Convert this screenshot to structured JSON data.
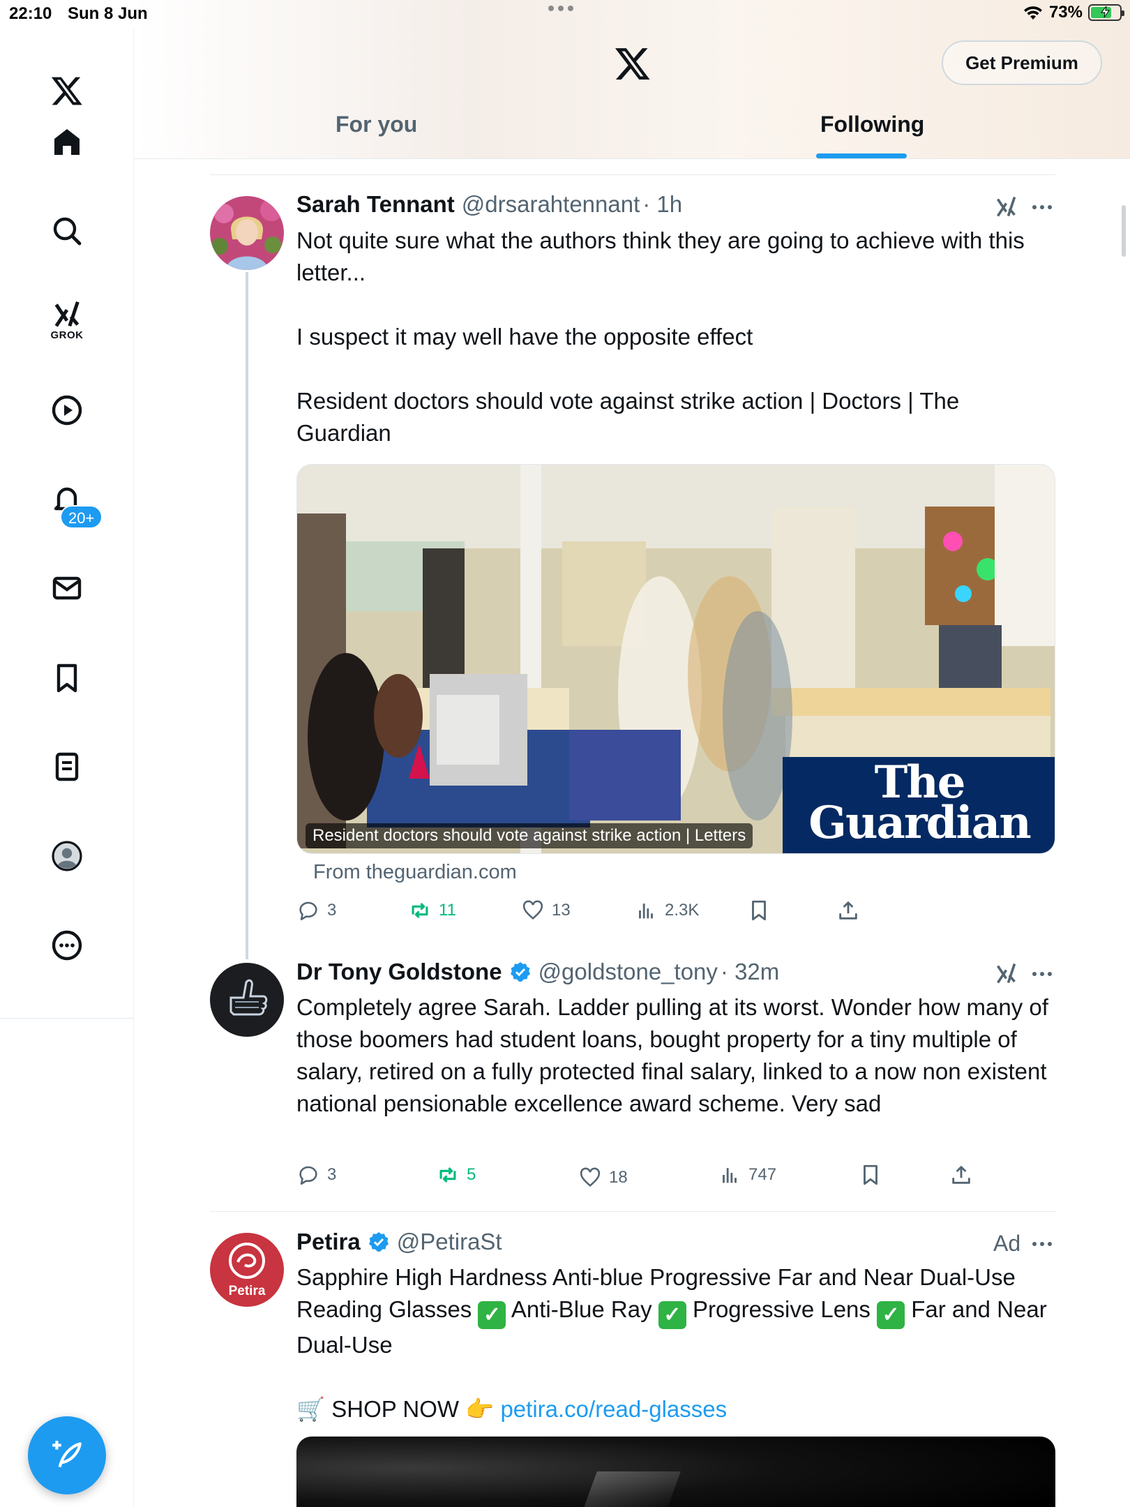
{
  "status_bar": {
    "time": "22:10",
    "date": "Sun 8 Jun",
    "battery": "73%",
    "battery_level": 0.73
  },
  "header": {
    "premium_label": "Get Premium",
    "tabs": [
      {
        "label": "For you",
        "active": false
      },
      {
        "label": "Following",
        "active": true
      }
    ]
  },
  "sidebar": {
    "grok_label": "GROK",
    "notifications_badge": "20+",
    "items": [
      "x-logo-icon",
      "home-icon",
      "search-icon",
      "grok-icon",
      "video-icon",
      "bell-icon",
      "mail-icon",
      "bookmark-icon",
      "list-icon",
      "profile-icon",
      "more-icon"
    ]
  },
  "tweets": [
    {
      "name": "Sarah Tennant",
      "handle": "@drsarahtennant",
      "time": "· 1h",
      "lines": [
        "Not quite sure what the authors think they are going to achieve with this letter...",
        "",
        "I suspect it may well have the opposite effect",
        "",
        "Resident doctors should vote against strike action | Doctors | The Guardian"
      ],
      "card": {
        "caption": "Resident doctors should vote against strike action | Letters",
        "brand": "The Guardian",
        "source": "From theguardian.com"
      },
      "stats": {
        "replies": "3",
        "reposts": "11",
        "likes": "13",
        "views": "2.3K"
      }
    },
    {
      "name": "Dr Tony Goldstone",
      "handle": "@goldstone_tony",
      "time": "· 32m",
      "text": "Completely agree Sarah. Ladder pulling at its worst. Wonder how many of those boomers had student loans, bought property for a tiny multiple of salary, retired on a fully protected final salary, linked to a now non existent national pensionable excellence award scheme. Very sad",
      "stats": {
        "replies": "3",
        "reposts": "5",
        "likes": "18",
        "views": "747"
      }
    },
    {
      "name": "Petira",
      "handle": "@PetiraSt",
      "ad_label": "Ad",
      "avatar_text": "Petira",
      "text_parts": [
        "Sapphire High Hardness Anti-blue Progressive Far and Near Dual-Use Reading Glasses",
        "Anti-Blue Ray",
        "Progressive Lens",
        "Far and Near Dual-Use"
      ],
      "shop_label": "SHOP NOW",
      "link": "petira.co/read-glasses"
    }
  ],
  "colors": {
    "accent": "#1d9bf0",
    "repost": "#00ba7c",
    "guardian_blue": "#052962",
    "text": "#0f1419",
    "muted": "#536471"
  }
}
